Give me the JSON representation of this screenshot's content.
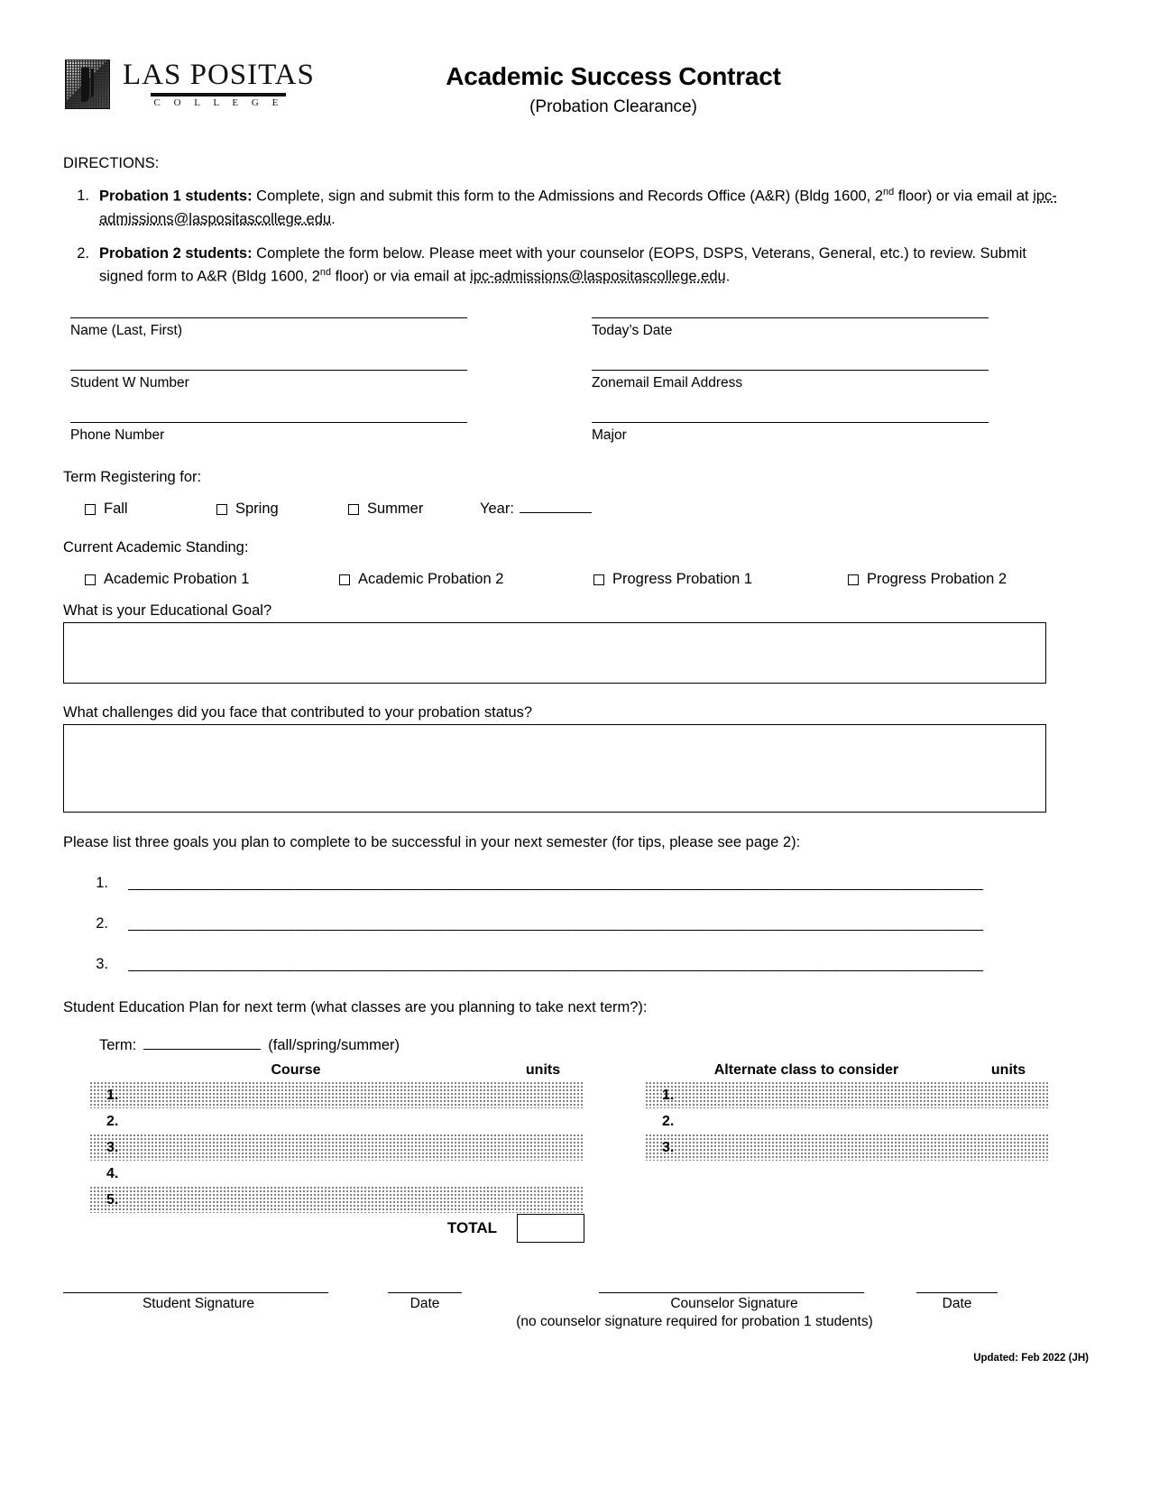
{
  "header": {
    "logo_name": "LAS POSITAS",
    "logo_sub": "C O L L E G E",
    "title": "Academic Success Contract",
    "subtitle": "(Probation Clearance)"
  },
  "directions": {
    "heading": "DIRECTIONS:",
    "items": [
      {
        "number": "1.",
        "bold_lead": "Probation 1 students:",
        "text_a": "  Complete, sign and submit this form to the Admissions and Records Office (A&R) (Bldg 1600, 2",
        "sup_a": "nd",
        "text_b": " floor) or via email at ",
        "link": "ipc-admissions@laspositascollege.edu",
        "text_c": "."
      },
      {
        "number": "2.",
        "bold_lead": "Probation 2 students:",
        "text_a": "  Complete the form below. Please meet with your counselor (EOPS, DSPS, Veterans, General, etc.) to review.  Submit signed form to A&R (Bldg 1600, 2",
        "sup_a": "nd",
        "text_b": " floor) or via email at ",
        "link": "ipc-admissions@laspositascollege.edu",
        "text_c": "."
      }
    ]
  },
  "fields": {
    "name": "Name (Last, First)",
    "todays_date": "Today’s Date",
    "w_number": "Student W Number",
    "zonemail": "Zonemail Email Address",
    "phone": "Phone Number",
    "major": "Major"
  },
  "term": {
    "label": "Term Registering for:",
    "options": [
      "Fall",
      "Spring",
      "Summer"
    ],
    "year_label": "Year:"
  },
  "standing": {
    "label": "Current Academic Standing:",
    "options": [
      "Academic Probation 1",
      "Academic Probation 2",
      "Progress Probation 1",
      "Progress Probation 2"
    ]
  },
  "questions": {
    "goal": "What is your Educational Goal?",
    "challenges": "What challenges did you face that contributed to your probation status?"
  },
  "goals": {
    "label": "Please list three goals you plan to complete to be successful in your next semester (for tips, please see page 2):",
    "numbers": [
      "1.",
      "2.",
      "3."
    ],
    "line": "______________________________________________________________________________________________________"
  },
  "sep": {
    "label": "Student Education Plan for next term (what classes are you planning to take next term?):",
    "term_label": "Term:",
    "term_hint": "(fall/spring/summer)",
    "left_table": {
      "col_course": "Course",
      "col_units": "units",
      "rows": [
        "1.",
        "2.",
        "3.",
        "4.",
        "5."
      ]
    },
    "right_table": {
      "col_course": "Alternate class to consider",
      "col_units": "units",
      "rows": [
        "1.",
        "2.",
        "3."
      ]
    },
    "total_label": "TOTAL"
  },
  "signatures": {
    "student_line": "________________________________",
    "date_line": "__________",
    "counselor_line": "________________________________",
    "date_line2": "__________",
    "student_label": "Student Signature",
    "date_label": "Date",
    "counselor_label": "Counselor Signature",
    "date_label2": "Date",
    "note": "(no counselor signature required for probation 1 students)"
  },
  "footer": {
    "updated": "Updated: Feb 2022 (JH)"
  }
}
